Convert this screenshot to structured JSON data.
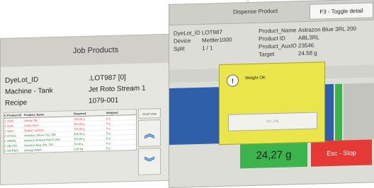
{
  "job_products": {
    "title": "Job Products",
    "fields": [
      {
        "label": "DyeLot_ID",
        "value": ".LOT987 [0]"
      },
      {
        "label": "Machine - Tank",
        "value": "Jet Roto Stream 1"
      },
      {
        "label": "Recipe",
        "value": "1079-001"
      }
    ],
    "table": {
      "headers": {
        "flag": "C",
        "id": "Product ID",
        "name": "Product_Name",
        "required": "Required",
        "weighed": "Weighed"
      },
      "rows": [
        {
          "flag": "1",
          "id": "A-9N",
          "name": "Amilan 9N",
          "required": "700,00 g",
          "weighed": "0 g",
          "color": "#e53935"
        },
        {
          "flag": "1",
          "id": "AcAc",
          "name": "Acetic Acid",
          "required": "400,00 g",
          "weighed": "0 g",
          "color": "#e53935"
        },
        {
          "flag": "1",
          "id": "NaAc",
          "name": "Sodium acetate",
          "required": "700,00 g",
          "weighed": "0 g",
          "color": "#e53935"
        },
        {
          "flag": "2",
          "id": "AYSGL",
          "name": "Astrazon Yellow 5GL 200",
          "required": "636,00 g",
          "weighed": "0 g",
          "color": "#2e7d32"
        },
        {
          "flag": "2",
          "id": "ABRRL",
          "name": "Astrazon Brilliant Red G 200",
          "required": "326,00 g",
          "weighed": "0 g",
          "color": "#2e7d32"
        },
        {
          "flag": "2",
          "id": "ABL3RL",
          "name": "Astrazon Blue 3RL 200",
          "required": "24,58 g",
          "weighed": "0 g",
          "color": "#2e7d32"
        },
        {
          "flag": "2",
          "id": "AR-RMA",
          "name": "Astragal RMA",
          "required": "2,00 kg",
          "weighed": "0 g",
          "color": "#2e7d32"
        }
      ]
    },
    "scroll_label": "Scroll View"
  },
  "dispense": {
    "title": "Dispense Product",
    "toggle_label": "F3 - Toggle detail",
    "dyelot_label": "DyeLot_ID",
    "dyelot_value": "LOT987",
    "device_label": "Device",
    "device_value": "Mettler1000",
    "split_label": "Split",
    "split_value": "1 / 1",
    "product_name_label": "Product_Name",
    "product_name_value": "Astrazon Blue 3RL 200",
    "product_id_label": "Product ID",
    "product_id_value": "ABL3RL",
    "aux_label": "Product_AuxID",
    "aux_value": "23546",
    "target_label": "Target",
    "target_value": "24.58 g",
    "weight": "24,27 g",
    "stop_label": "Esc - Stop"
  },
  "dialog": {
    "message": "Weight OK",
    "icon_glyph": "!",
    "ok_label": "F9 - OK"
  },
  "colors": {
    "bar_blue": "#2f5fa8",
    "bar_green": "#3cb44b",
    "dialog_yellow": "#eae54a",
    "stop_red": "#e53935"
  }
}
